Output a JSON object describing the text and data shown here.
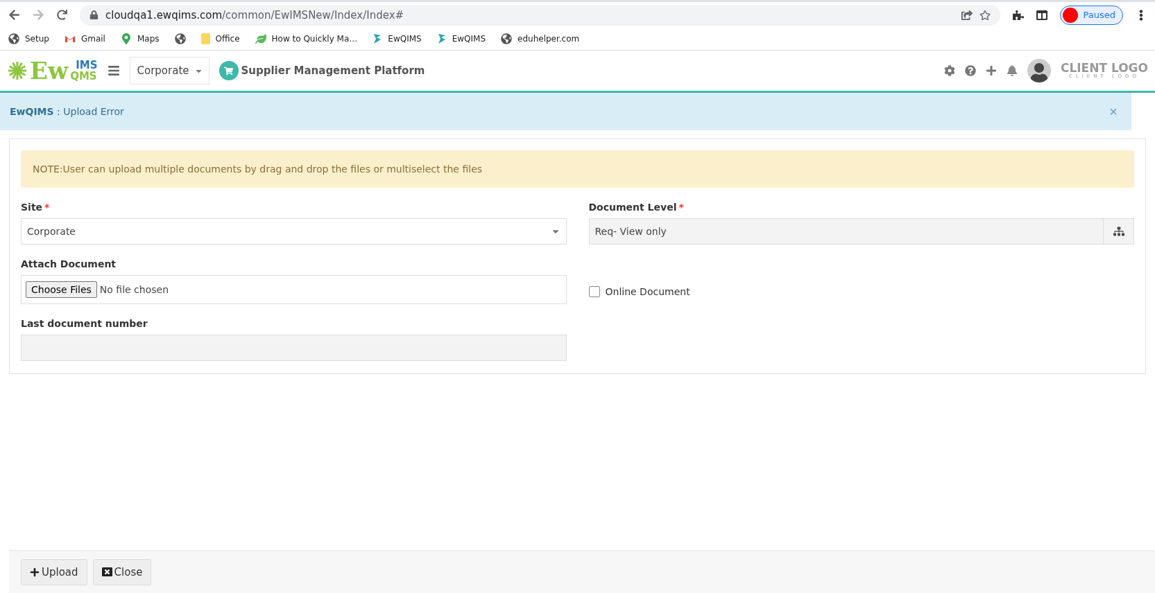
{
  "browser": {
    "url_host": "cloudqa1.ewqims.com",
    "url_path": "/common/EwIMSNew/Index/Index#",
    "profile": "Paused"
  },
  "bookmarks": [
    {
      "kind": "globe",
      "label": "Setup"
    },
    {
      "kind": "mail",
      "label": "Gmail"
    },
    {
      "kind": "pin",
      "label": "Maps"
    },
    {
      "kind": "globe"
    },
    {
      "kind": "folder",
      "label": "Office"
    },
    {
      "kind": "leaf",
      "label": "How to Quickly Ma…"
    },
    {
      "kind": "app",
      "label": "EwQIMS"
    },
    {
      "kind": "app",
      "label": "EwQIMS"
    },
    {
      "kind": "globe",
      "label": "eduhelper.com"
    }
  ],
  "header": {
    "logo_main": "Ew",
    "logo_top": "IMS",
    "logo_bottom": "QMS",
    "site": "Corporate",
    "platform": "Supplier Management Platform",
    "client_logo": "CLIENT LOGO",
    "client_logo_sub": "CLIENT LOGO"
  },
  "alert": {
    "text": "**EwQIMS** : Upload Error",
    "close": "×"
  },
  "note": "NOTE:User can upload multiple documents by drag and drop the files or multiselect the files",
  "required_mark": "*",
  "rows": [
    [
      {
        "kind": "select",
        "label": "Site",
        "required": true,
        "value": "Corporate"
      },
      {
        "kind": "tree",
        "label": "Document Level",
        "required": true,
        "value": "Req- View only"
      }
    ],
    [
      {
        "kind": "file",
        "label": "Attach Document",
        "required": false,
        "button": "Choose Files",
        "value": "No file chosen"
      },
      {
        "kind": "checkbox",
        "label": "Online Document",
        "checked": false
      }
    ],
    [
      {
        "kind": "readonly",
        "label": "Last document number",
        "required": false
      }
    ]
  ],
  "buttons": [
    {
      "kind": "upload",
      "label": "Upload"
    },
    {
      "kind": "close",
      "label": "Close"
    }
  ]
}
